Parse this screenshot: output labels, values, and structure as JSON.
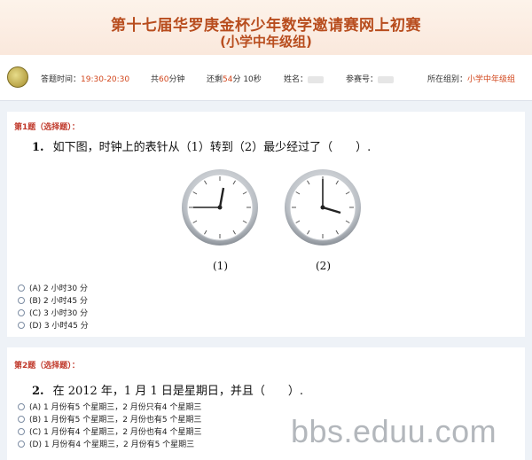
{
  "header": {
    "title": "第十七届华罗庚金杯少年数学邀请赛网上初赛",
    "subtitle": "(小学中年级组)"
  },
  "info": {
    "answer_time_label": "答题时间：",
    "answer_time_value": "19:30-20:30",
    "total_prefix": "共",
    "total_value": "60",
    "total_suffix": "分钟",
    "remain_prefix": "还剩",
    "remain_value": "54",
    "remain_mid": "分 10秒",
    "name_label": "姓名：",
    "ticket_label": "参赛号：",
    "group_label": "所在组别：",
    "group_value": "小学中年级组"
  },
  "q1": {
    "heading": "第1题（选择题）：",
    "number": "1.",
    "text": "如下图，时钟上的表针从（1）转到（2）最少经过了（　　）.",
    "clock1_caption": "(1)",
    "clock2_caption": "(2)",
    "options": [
      "(A) 2 小时30 分",
      "(B) 2 小时45 分",
      "(C) 3 小时30 分",
      "(D) 3 小时45 分"
    ]
  },
  "q2": {
    "heading": "第2题（选择题）：",
    "number": "2.",
    "text": "在 2012 年，1 月 1 日是星期日，并且（　　）.",
    "options": [
      "(A) 1 月份有5 个星期三，2 月份只有4 个星期三",
      "(B) 1 月份有5 个星期三，2 月份也有5 个星期三",
      "(C) 1 月份有4 个星期三，2 月份也有4 个星期三",
      "(D) 1 月份有4 个星期三，2 月份有5 个星期三"
    ]
  },
  "watermark": "bbs.eduu.com"
}
